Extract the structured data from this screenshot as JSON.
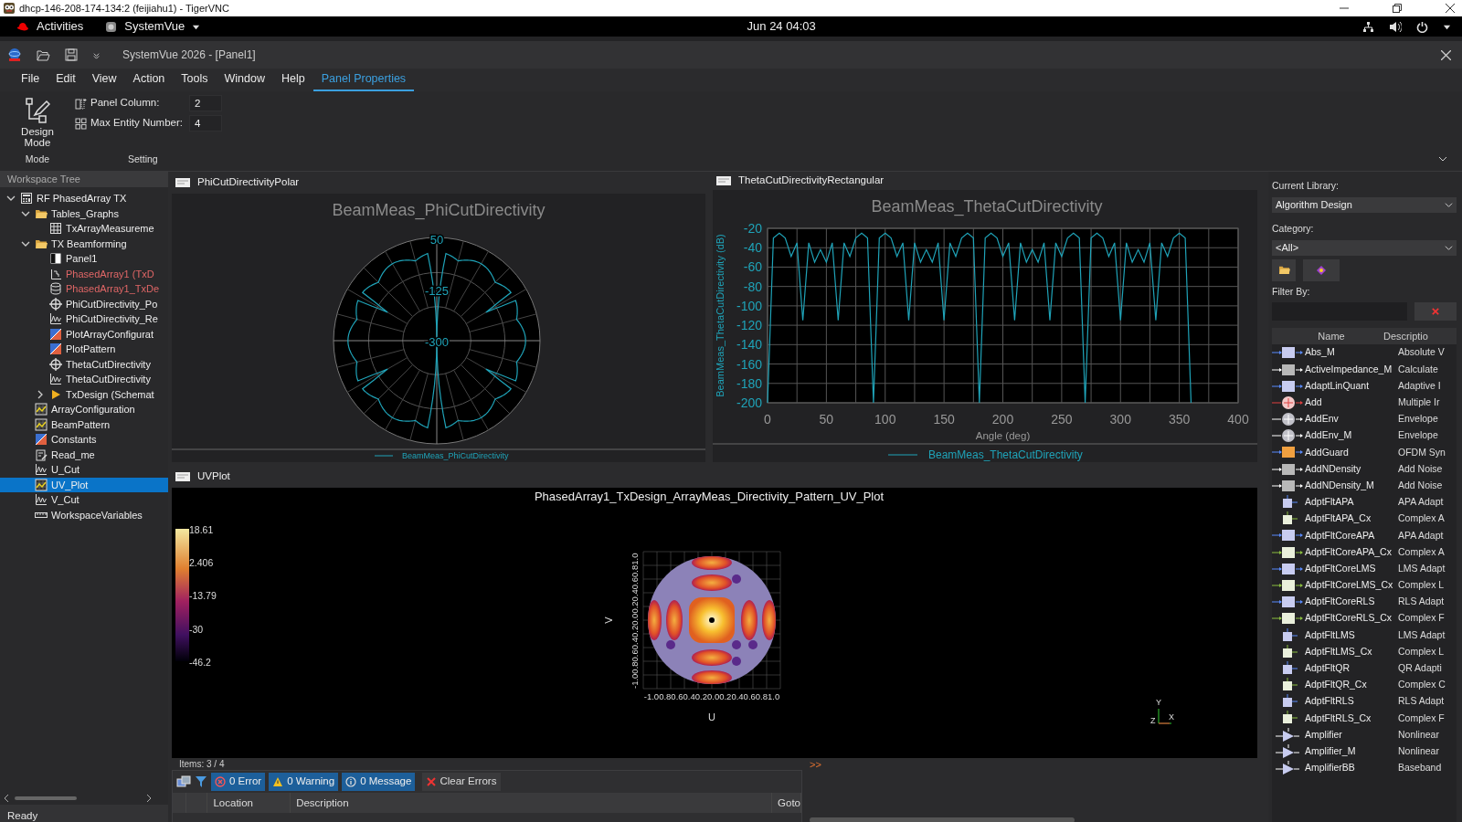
{
  "vnc_window": {
    "title": "dhcp-146-208-174-134:2 (feijiahu1) - TigerVNC"
  },
  "top_bar": {
    "activities": "Activities",
    "app_menu": "SystemVue",
    "clock": "Jun 24  04:03"
  },
  "app": {
    "title": "SystemVue 2026 - [Panel1]"
  },
  "menu": [
    {
      "label": "File",
      "selected": false
    },
    {
      "label": "Edit",
      "selected": false
    },
    {
      "label": "View",
      "selected": false
    },
    {
      "label": "Action",
      "selected": false
    },
    {
      "label": "Tools",
      "selected": false
    },
    {
      "label": "Window",
      "selected": false
    },
    {
      "label": "Help",
      "selected": false
    },
    {
      "label": "Panel Properties",
      "selected": true
    }
  ],
  "ribbon": {
    "design_mode": "Design Mode",
    "settings": [
      {
        "kind": "column",
        "label": "Panel Column:",
        "value": "2"
      },
      {
        "kind": "grid",
        "label": "Max Entity Number:",
        "value": "4"
      }
    ],
    "groups": [
      "Mode",
      "Setting"
    ]
  },
  "workspace_tree": {
    "title": "Workspace Tree",
    "items": [
      {
        "label": "RF PhasedArray TX",
        "kind": "workspace",
        "selected": false,
        "expanded": true,
        "children": [
          {
            "label": "Tables_Graphs",
            "kind": "folder",
            "selected": false,
            "expanded": true,
            "children": [
              {
                "label": "TxArrayMeasureme",
                "kind": "table",
                "selected": false
              }
            ]
          },
          {
            "label": "TX Beamforming",
            "kind": "folder",
            "selected": false,
            "expanded": true,
            "children": [
              {
                "label": "Panel1",
                "kind": "panel",
                "selected": false
              },
              {
                "label": "PhasedArray1 (TxD",
                "kind": "schematic",
                "selected": false,
                "color": "#e06666"
              },
              {
                "label": "PhasedArray1_TxDe",
                "kind": "dataset",
                "selected": false,
                "color": "#e06666"
              },
              {
                "label": "PhiCutDirectivity_Po",
                "kind": "polar",
                "selected": false
              },
              {
                "label": "PhiCutDirectivity_Re",
                "kind": "graph",
                "selected": false
              },
              {
                "label": "PlotArrayConfigurat",
                "kind": "equation",
                "selected": false
              },
              {
                "label": "PlotPattern",
                "kind": "equation",
                "selected": false
              },
              {
                "label": "ThetaCutDirectivity",
                "kind": "polar",
                "selected": false
              },
              {
                "label": "ThetaCutDirectivity",
                "kind": "graph",
                "selected": false
              },
              {
                "label": "TxDesign (Schemat",
                "kind": "design",
                "selected": false,
                "expanded": false
              }
            ]
          },
          {
            "label": "ArrayConfiguration",
            "kind": "chart3d",
            "selected": false
          },
          {
            "label": "BeamPattern",
            "kind": "chart3d",
            "selected": false
          },
          {
            "label": "Constants",
            "kind": "equation",
            "selected": false
          },
          {
            "label": "Read_me",
            "kind": "note",
            "selected": false
          },
          {
            "label": "U_Cut",
            "kind": "graph",
            "selected": false
          },
          {
            "label": "UV_Plot",
            "kind": "chart3d",
            "selected": true
          },
          {
            "label": "V_Cut",
            "kind": "graph",
            "selected": false
          },
          {
            "label": "WorkspaceVariables",
            "kind": "variables",
            "selected": false
          }
        ]
      }
    ]
  },
  "status_bar": "Ready",
  "polar_panel": {
    "title": "PhiCutDirectivityPolar",
    "plot_title": "BeamMeas_PhiCutDirectivity",
    "radial_labels": [
      "50",
      "-125",
      "-300"
    ],
    "legend": "BeamMeas_PhiCutDirectivity"
  },
  "rect_panel": {
    "title": "ThetaCutDirectivityRectangular",
    "chart_data": {
      "type": "line",
      "title": "BeamMeas_ThetaCutDirectivity",
      "xlabel": "Angle (deg)",
      "ylabel": "BeamMeas_ThetaCutDirectivity (dB)",
      "grid": true,
      "x": [
        0,
        5,
        10,
        15,
        20,
        25,
        30,
        35,
        40,
        45,
        50,
        55,
        60,
        65,
        70,
        75,
        80,
        85,
        90,
        95,
        100,
        105,
        110,
        115,
        120,
        125,
        130,
        135,
        140,
        145,
        150,
        155,
        160,
        165,
        170,
        175,
        180,
        185,
        190,
        195,
        200,
        205,
        210,
        215,
        220,
        225,
        230,
        235,
        240,
        245,
        250,
        255,
        260,
        265,
        270,
        275,
        280,
        285,
        290,
        295,
        300,
        305,
        310,
        315,
        320,
        325,
        330,
        335,
        340,
        345,
        350,
        355,
        360
      ],
      "series": [
        {
          "name": "BeamMeas_ThetaCutDirectivity",
          "color": "#1fa3b8",
          "values": [
            -200,
            -30,
            -25,
            -30,
            -49,
            -35,
            -115,
            -35,
            -55,
            -42,
            -55,
            -35,
            -115,
            -35,
            -49,
            -30,
            -25,
            -30,
            -200,
            -30,
            -25,
            -30,
            -49,
            -35,
            -115,
            -35,
            -55,
            -42,
            -55,
            -35,
            -115,
            -35,
            -49,
            -30,
            -25,
            -30,
            -200,
            -30,
            -25,
            -30,
            -49,
            -35,
            -115,
            -35,
            -55,
            -42,
            -55,
            -35,
            -115,
            -35,
            -49,
            -30,
            -25,
            -30,
            -200,
            -30,
            -25,
            -30,
            -49,
            -35,
            -115,
            -35,
            -55,
            -42,
            -55,
            -35,
            -115,
            -35,
            -49,
            -30,
            -25,
            -30,
            -200
          ]
        }
      ],
      "xlim": [
        0,
        400
      ],
      "ylim": [
        -200,
        -20
      ],
      "xticks": [
        0,
        50,
        100,
        150,
        200,
        250,
        300,
        350,
        400
      ],
      "yticks": [
        -200,
        -180,
        -160,
        -140,
        -120,
        -100,
        -80,
        -60,
        -40,
        -20
      ]
    }
  },
  "uv_panel": {
    "title": "UVPlot",
    "plot_title": "PhasedArray1_TxDesign_ArrayMeas_Directivity_Pattern_UV_Plot",
    "colorbar_labels": [
      "18.61",
      "2.406",
      "-13.79",
      "-30",
      "-46.2"
    ],
    "x_ticks": "-1.00.80.60.40.20.00.20.40.60.81.0",
    "y_ticks": "-1.00.80.60.40.20.00.20.40.60.81.0",
    "xlabel": "U",
    "ylabel": "V",
    "triad": [
      "Y",
      "Z",
      "X"
    ]
  },
  "messages": {
    "items_count": "Items: 3 / 4",
    "filters": [
      {
        "kind": "error",
        "label": "0 Error"
      },
      {
        "kind": "warning",
        "label": "0 Warning"
      },
      {
        "kind": "info",
        "label": "0 Message"
      }
    ],
    "clear": "Clear Errors",
    "columns": [
      "Location",
      "Description",
      "Goto"
    ],
    "console_prompt": ">>"
  },
  "library": {
    "current_label": "Current Library:",
    "current": "Algorithm Design",
    "category_label": "Category:",
    "category": "<All>",
    "filter_label": "Filter By:",
    "columns": [
      "Name",
      "Descriptio"
    ],
    "rows": [
      {
        "kind": "block",
        "name": "Abs_M",
        "description": "Absolute V"
      },
      {
        "kind": "block_gray",
        "name": "ActiveImpedance_M",
        "description": "Calculate"
      },
      {
        "kind": "block",
        "name": "AdaptLinQuant",
        "description": "Adaptive I"
      },
      {
        "kind": "adder",
        "name": "Add",
        "description": "Multiple Ir"
      },
      {
        "kind": "adder_gray",
        "name": "AddEnv",
        "description": "Envelope"
      },
      {
        "kind": "adder_gray",
        "name": "AddEnv_M",
        "description": "Envelope"
      },
      {
        "kind": "guard",
        "name": "AddGuard",
        "description": "OFDM Syn"
      },
      {
        "kind": "block_gray",
        "name": "AddNDensity",
        "description": "Add Noise"
      },
      {
        "kind": "block_gray",
        "name": "AddNDensity_M",
        "description": "Add Noise"
      },
      {
        "kind": "small",
        "name": "AdptFltAPA",
        "description": "APA Adapt"
      },
      {
        "kind": "small_green",
        "name": "AdptFltAPA_Cx",
        "description": "Complex A"
      },
      {
        "kind": "block",
        "name": "AdptFltCoreAPA",
        "description": "APA Adapt"
      },
      {
        "kind": "block_green",
        "name": "AdptFltCoreAPA_Cx",
        "description": "Complex A"
      },
      {
        "kind": "block",
        "name": "AdptFltCoreLMS",
        "description": "LMS Adapt"
      },
      {
        "kind": "block_green",
        "name": "AdptFltCoreLMS_Cx",
        "description": "Complex L"
      },
      {
        "kind": "block",
        "name": "AdptFltCoreRLS",
        "description": "RLS Adapt"
      },
      {
        "kind": "block_green",
        "name": "AdptFltCoreRLS_Cx",
        "description": "Complex F"
      },
      {
        "kind": "small",
        "name": "AdptFltLMS",
        "description": "LMS Adapt"
      },
      {
        "kind": "small_green",
        "name": "AdptFltLMS_Cx",
        "description": "Complex L"
      },
      {
        "kind": "small",
        "name": "AdptFltQR",
        "description": "QR Adapti"
      },
      {
        "kind": "small_green",
        "name": "AdptFltQR_Cx",
        "description": "Complex C"
      },
      {
        "kind": "small",
        "name": "AdptFltRLS",
        "description": "RLS Adapt"
      },
      {
        "kind": "small_green",
        "name": "AdptFltRLS_Cx",
        "description": "Complex F"
      },
      {
        "kind": "amp",
        "name": "Amplifier",
        "description": "Nonlinear"
      },
      {
        "kind": "amp",
        "name": "Amplifier_M",
        "description": "Nonlinear"
      },
      {
        "kind": "amp",
        "name": "AmplifierBB",
        "description": "Baseband"
      }
    ]
  }
}
